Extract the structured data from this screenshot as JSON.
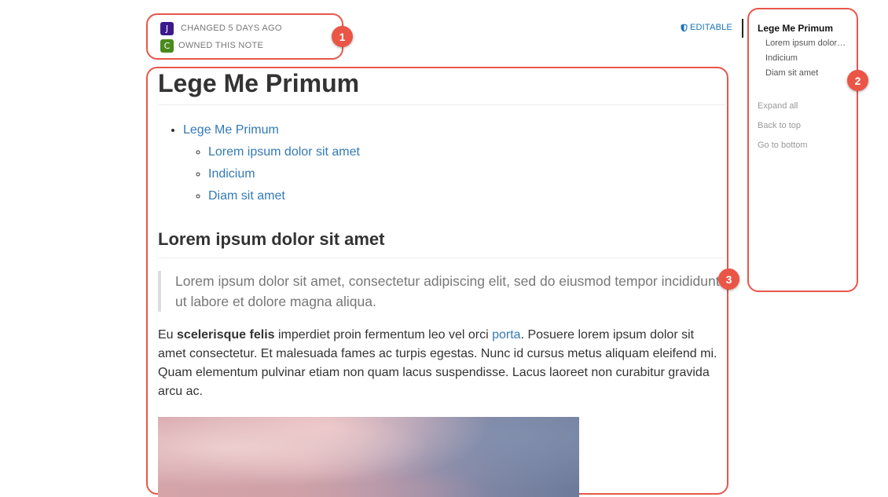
{
  "meta": {
    "changed": {
      "avatar_letter": "J",
      "avatar_color": "#3b1a8c",
      "text": "CHANGED 5 DAYS AGO"
    },
    "owner": {
      "avatar_letter": "C",
      "avatar_color": "#4a8a1c",
      "text": "OWNED THIS NOTE"
    },
    "permission": {
      "label": "EDITABLE",
      "icon": "shield-icon"
    }
  },
  "content": {
    "title": "Lege Me Primum",
    "toc": {
      "top": "Lege Me Primum",
      "children": [
        "Lorem ipsum dolor sit amet",
        "Indicium",
        "Diam sit amet"
      ]
    },
    "section_title": "Lorem ipsum dolor sit amet",
    "quote": "Lorem ipsum dolor sit amet, consectetur adipiscing elit, sed do eiusmod tempor incididunt ut labore et dolore magna aliqua.",
    "para": {
      "p1": "Eu ",
      "bold": "scelerisque felis",
      "p2": " imperdiet proin fermentum leo vel orci ",
      "link": "porta",
      "p3": ". Posuere lorem ipsum dolor sit amet consectetur. Et malesuada fames ac turpis egestas. Nunc id cursus metus aliquam eleifend mi. Quam elementum pulvinar etiam non quam lacus suspendisse. Lacus laoreet non curabitur gravida arcu ac."
    }
  },
  "sidebar": {
    "title": "Lege Me Primum",
    "items": [
      "Lorem ipsum dolor sit amet",
      "Indicium",
      "Diam sit amet"
    ],
    "expand_all": "Expand all",
    "back_to_top": "Back to top",
    "go_to_bottom": "Go to bottom"
  },
  "annotations": {
    "one": "1",
    "two": "2",
    "three": "3",
    "color": "#e8564a"
  }
}
